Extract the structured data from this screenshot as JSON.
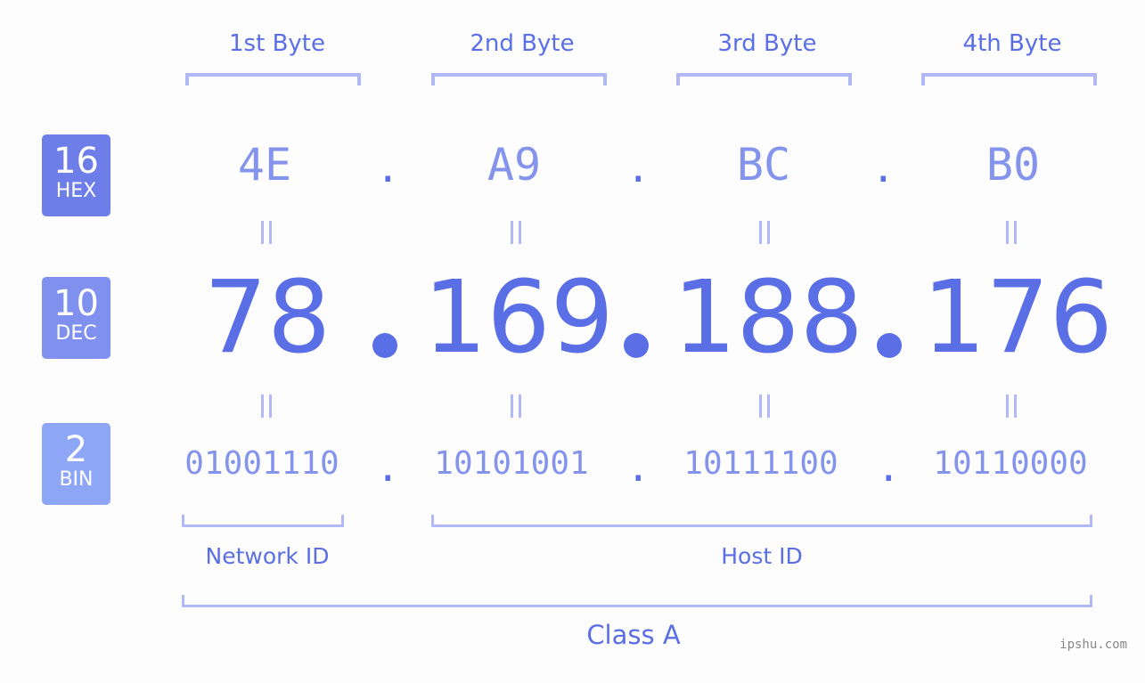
{
  "byte_headers": [
    "1st Byte",
    "2nd Byte",
    "3rd Byte",
    "4th Byte"
  ],
  "badges": [
    {
      "number": "16",
      "label": "HEX",
      "color": "#6e7ee8"
    },
    {
      "number": "10",
      "label": "DEC",
      "color": "#8090ee"
    },
    {
      "number": "2",
      "label": "BIN",
      "color": "#8ea6f6"
    }
  ],
  "hex": [
    "4E",
    "A9",
    "BC",
    "B0"
  ],
  "dec": [
    "78",
    "169",
    "188",
    "176"
  ],
  "bin": [
    "01001110",
    "10101001",
    "10111100",
    "10110000"
  ],
  "separator": ".",
  "network_id_label": "Network ID",
  "host_id_label": "Host ID",
  "class_label": "Class A",
  "watermark": "ipshu.com",
  "colors": {
    "primary": "#5a6ee6",
    "light": "#8494ec",
    "bracket": "#b0b9f6"
  }
}
